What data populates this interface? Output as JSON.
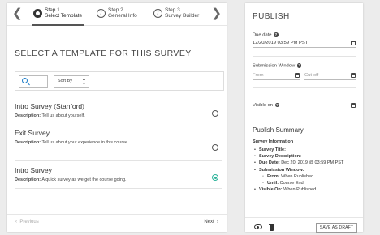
{
  "stepper": {
    "steps": [
      {
        "line1": "Step 1",
        "line2": "Select Template",
        "active": true
      },
      {
        "line1": "Step 2",
        "line2": "General Info",
        "active": false
      },
      {
        "line1": "Step 3",
        "line2": "Survey Builder",
        "active": false
      }
    ]
  },
  "left": {
    "heading": "SELECT A TEMPLATE FOR THIS SURVEY",
    "search": {
      "placeholder": ""
    },
    "sort_label": "Sort By",
    "templates": [
      {
        "name": "Intro Survey (Stanford)",
        "desc_label": "Description:",
        "desc": "Tell us about yourself.",
        "selected": false
      },
      {
        "name": "Exit Survey",
        "desc_label": "Description:",
        "desc": "Tell us about your experience in this course.",
        "selected": false
      },
      {
        "name": "Intro Survey",
        "desc_label": "Description:",
        "desc": "A quick survey as we get the course going.",
        "selected": true
      }
    ],
    "prev_label": "Previous",
    "next_label": "Next"
  },
  "right": {
    "title": "PUBLISH",
    "due_date_label": "Due date",
    "due_date_value": "12/20/2019 03:59 PM PST",
    "submission_window_label": "Submission Window",
    "from_placeholder": "From",
    "cutoff_placeholder": "Cut-off",
    "visible_on_label": "Visible on",
    "visible_on_value": "",
    "summary_title": "Publish Summary",
    "summary_subtitle": "Survey Information",
    "summary": {
      "survey_title_label": "Survey Title:",
      "survey_desc_label": "Survey Description:",
      "due_date_label": "Due Date:",
      "due_date_value": "Dec 20, 2019 @ 03:59 PM PST",
      "submission_window_label": "Submission Window:",
      "from_label": "From:",
      "from_value": "When Published",
      "until_label": "Until:",
      "until_value": "Course End",
      "visible_on_label": "Visible On:",
      "visible_on_value": "When Published"
    },
    "save_draft_label": "SAVE AS DRAFT"
  },
  "colors": {
    "accent_green": "#2cb39a",
    "search_blue": "#1c7cc7"
  }
}
